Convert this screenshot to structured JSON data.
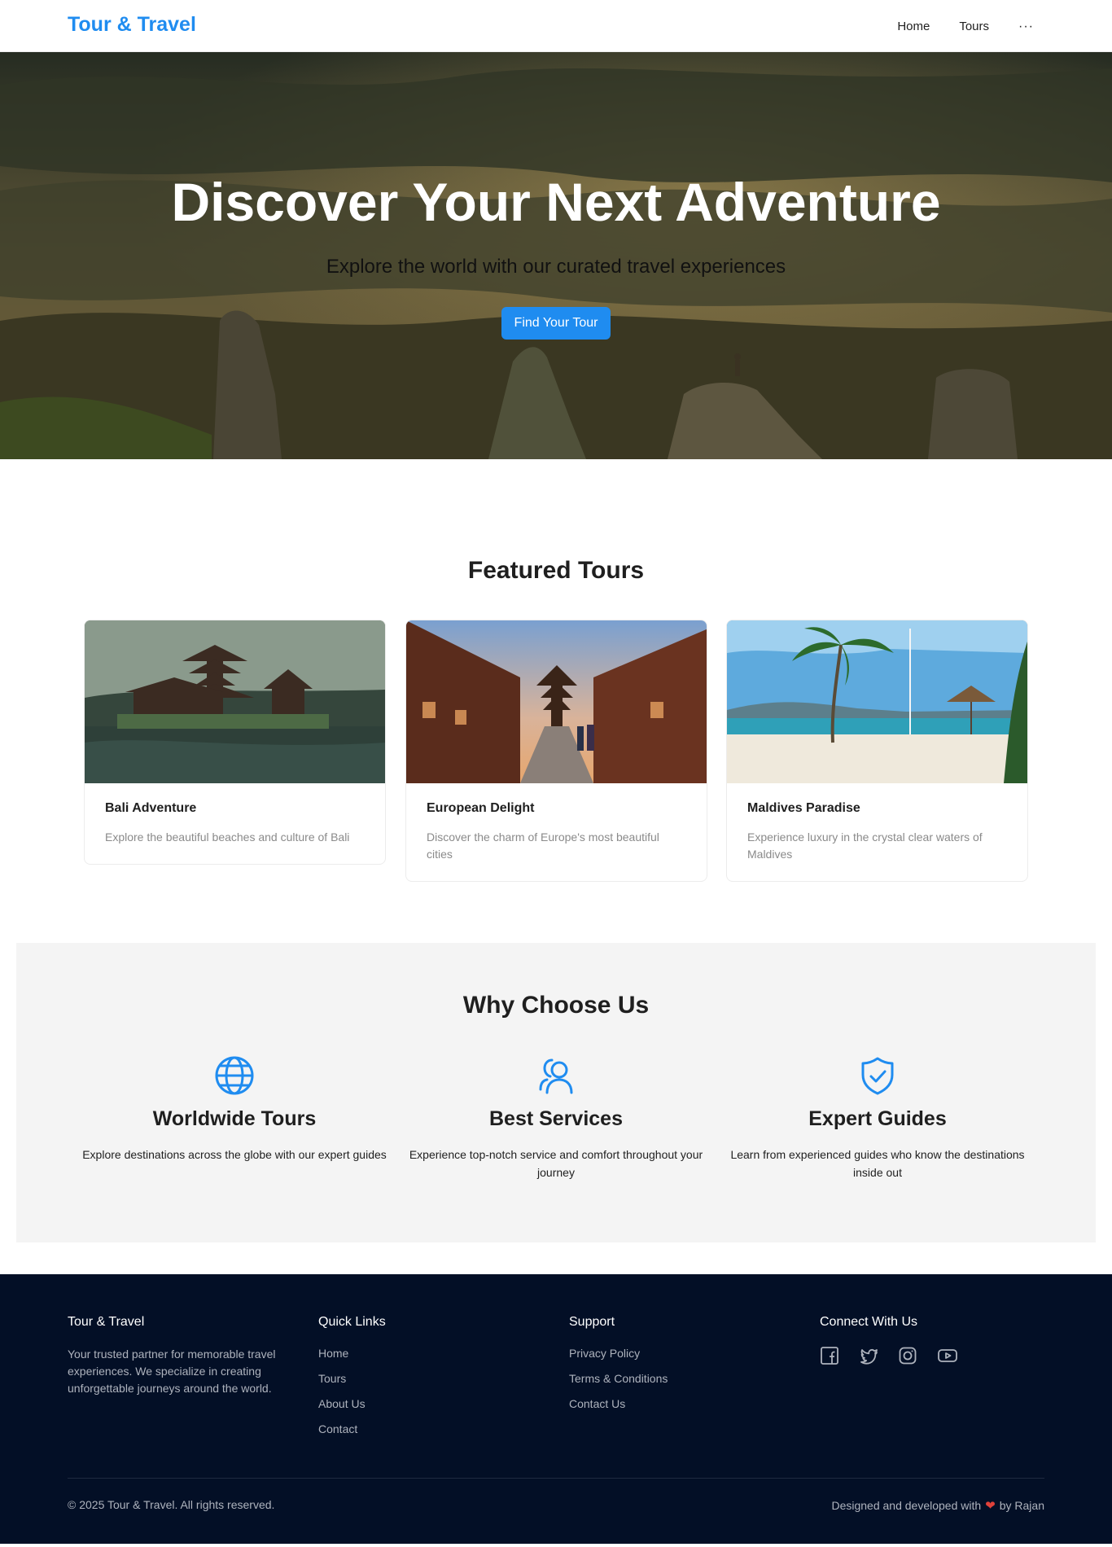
{
  "header": {
    "brand": "Tour & Travel",
    "nav": [
      "Home",
      "Tours"
    ],
    "more_label": "···"
  },
  "hero": {
    "title": "Discover Your Next Adventure",
    "subtitle": "Explore the world with our curated travel experiences",
    "cta_label": "Find Your Tour"
  },
  "featured": {
    "title": "Featured Tours",
    "cards": [
      {
        "title": "Bali Adventure",
        "description": "Explore the beautiful beaches and culture of Bali"
      },
      {
        "title": "European Delight",
        "description": "Discover the charm of Europe's most beautiful cities"
      },
      {
        "title": "Maldives Paradise",
        "description": "Experience luxury in the crystal clear waters of Maldives"
      }
    ]
  },
  "why": {
    "title": "Why Choose Us",
    "features": [
      {
        "icon": "globe-icon",
        "title": "Worldwide Tours",
        "description": "Explore destinations across the globe with our expert guides"
      },
      {
        "icon": "user-group-icon",
        "title": "Best Services",
        "description": "Experience top-notch service and comfort throughout your journey"
      },
      {
        "icon": "shield-check-icon",
        "title": "Expert Guides",
        "description": "Learn from experienced guides who know the destinations inside out"
      }
    ]
  },
  "footer": {
    "about_title": "Tour & Travel",
    "about_text": "Your trusted partner for memorable travel experiences. We specialize in creating unforgettable journeys around the world.",
    "quick_links_title": "Quick Links",
    "quick_links": [
      "Home",
      "Tours",
      "About Us",
      "Contact"
    ],
    "support_title": "Support",
    "support_links": [
      "Privacy Policy",
      "Terms & Conditions",
      "Contact Us"
    ],
    "connect_title": "Connect With Us",
    "social": [
      "facebook-icon",
      "twitter-icon",
      "instagram-icon",
      "youtube-icon"
    ],
    "copyright": "© 2025 Tour & Travel. All rights reserved.",
    "credit_prefix": "Designed and developed with",
    "credit_suffix": "by Rajan"
  },
  "colors": {
    "accent": "#1f8cf0",
    "footer_bg": "#030f26",
    "section_bg": "#f4f4f4",
    "heart": "#e0413a"
  }
}
